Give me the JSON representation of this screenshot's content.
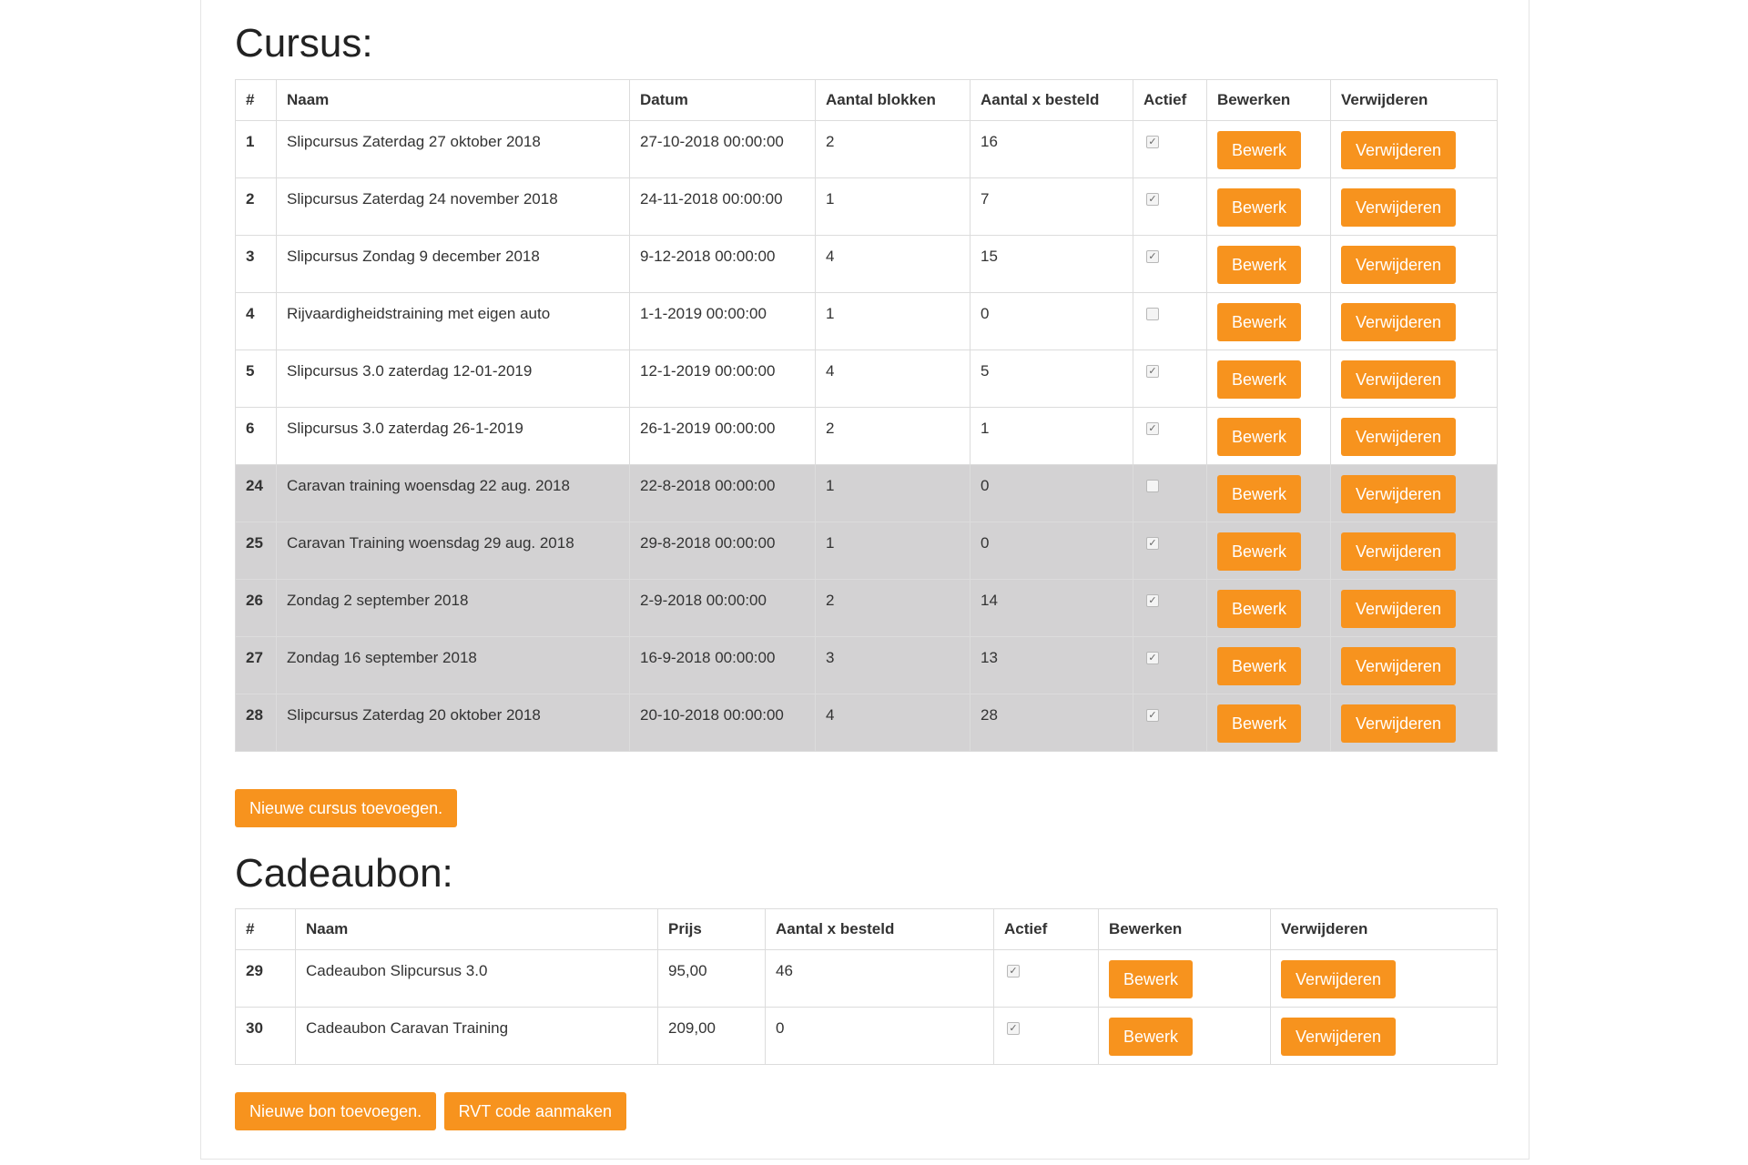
{
  "colors": {
    "accent": "#f7931e",
    "inactive_row_bg": "#d3d2d3"
  },
  "cursus": {
    "title": "Cursus:",
    "headers": [
      "#",
      "Naam",
      "Datum",
      "Aantal blokken",
      "Aantal x besteld",
      "Actief",
      "Bewerken",
      "Verwijderen"
    ],
    "rows": [
      {
        "id": "1",
        "naam": "Slipcursus Zaterdag 27 oktober 2018",
        "datum": "27-10-2018 00:00:00",
        "blokken": "2",
        "besteld": "16",
        "actief": true,
        "grey": false
      },
      {
        "id": "2",
        "naam": "Slipcursus Zaterdag 24 november 2018",
        "datum": "24-11-2018 00:00:00",
        "blokken": "1",
        "besteld": "7",
        "actief": true,
        "grey": false
      },
      {
        "id": "3",
        "naam": "Slipcursus Zondag 9 december 2018",
        "datum": "9-12-2018 00:00:00",
        "blokken": "4",
        "besteld": "15",
        "actief": true,
        "grey": false
      },
      {
        "id": "4",
        "naam": "Rijvaardigheidstraining met eigen auto",
        "datum": "1-1-2019 00:00:00",
        "blokken": "1",
        "besteld": "0",
        "actief": false,
        "grey": false
      },
      {
        "id": "5",
        "naam": "Slipcursus 3.0 zaterdag 12-01-2019",
        "datum": "12-1-2019 00:00:00",
        "blokken": "4",
        "besteld": "5",
        "actief": true,
        "grey": false
      },
      {
        "id": "6",
        "naam": "Slipcursus 3.0 zaterdag 26-1-2019",
        "datum": "26-1-2019 00:00:00",
        "blokken": "2",
        "besteld": "1",
        "actief": true,
        "grey": false
      },
      {
        "id": "24",
        "naam": "Caravan training woensdag 22 aug. 2018",
        "datum": "22-8-2018 00:00:00",
        "blokken": "1",
        "besteld": "0",
        "actief": false,
        "grey": true
      },
      {
        "id": "25",
        "naam": "Caravan Training woensdag 29 aug. 2018",
        "datum": "29-8-2018 00:00:00",
        "blokken": "1",
        "besteld": "0",
        "actief": true,
        "grey": true
      },
      {
        "id": "26",
        "naam": "Zondag 2 september 2018",
        "datum": "2-9-2018 00:00:00",
        "blokken": "2",
        "besteld": "14",
        "actief": true,
        "grey": true
      },
      {
        "id": "27",
        "naam": "Zondag 16 september 2018",
        "datum": "16-9-2018 00:00:00",
        "blokken": "3",
        "besteld": "13",
        "actief": true,
        "grey": true
      },
      {
        "id": "28",
        "naam": "Slipcursus Zaterdag 20 oktober 2018",
        "datum": "20-10-2018 00:00:00",
        "blokken": "4",
        "besteld": "28",
        "actief": true,
        "grey": true
      }
    ],
    "edit_label": "Bewerk",
    "delete_label": "Verwijderen",
    "add_label": "Nieuwe cursus toevoegen."
  },
  "cadeaubon": {
    "title": "Cadeaubon:",
    "headers": [
      "#",
      "Naam",
      "Prijs",
      "Aantal x besteld",
      "Actief",
      "Bewerken",
      "Verwijderen"
    ],
    "rows": [
      {
        "id": "29",
        "naam": "Cadeaubon Slipcursus 3.0",
        "prijs": "95,00",
        "besteld": "46",
        "actief": true
      },
      {
        "id": "30",
        "naam": "Cadeaubon Caravan Training",
        "prijs": "209,00",
        "besteld": "0",
        "actief": true
      }
    ],
    "edit_label": "Bewerk",
    "delete_label": "Verwijderen",
    "add_label": "Nieuwe bon toevoegen.",
    "rvt_label": "RVT code aanmaken"
  }
}
